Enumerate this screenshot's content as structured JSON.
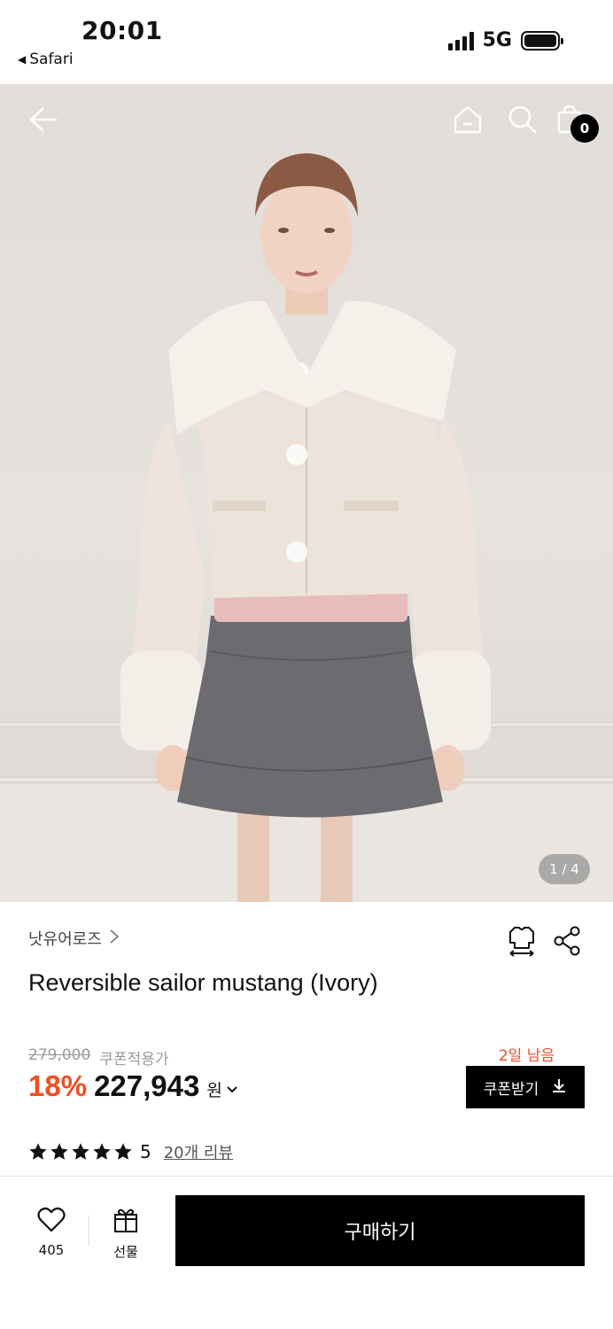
{
  "status_bar": {
    "time": "20:01",
    "back_app": "Safari",
    "network": "5G"
  },
  "header": {
    "cart_count": "0"
  },
  "gallery": {
    "page_indicator": "1 / 4"
  },
  "product": {
    "brand": "낫유어로즈",
    "title": "Reversible sailor mustang (Ivory)",
    "original_price": "279,000",
    "coupon_price_label": "쿠폰적용가",
    "discount_rate": "18%",
    "price": "227,943",
    "currency": "원",
    "days_left": "2일 남음",
    "coupon_button": "쿠폰받기",
    "rating": "5",
    "rating_stars": 5,
    "review_link": "20개 리뷰"
  },
  "bottom_bar": {
    "like_count": "405",
    "gift_label": "선물",
    "buy_label": "구매하기"
  },
  "colors": {
    "accent": "#f04e23",
    "primary_button": "#000000"
  },
  "icons": [
    "back-arrow-icon",
    "home-icon",
    "search-icon",
    "shopping-bag-icon",
    "chevron-right-icon",
    "size-guide-icon",
    "share-icon",
    "chevron-down-icon",
    "download-icon",
    "star-icon",
    "heart-icon",
    "gift-icon"
  ]
}
